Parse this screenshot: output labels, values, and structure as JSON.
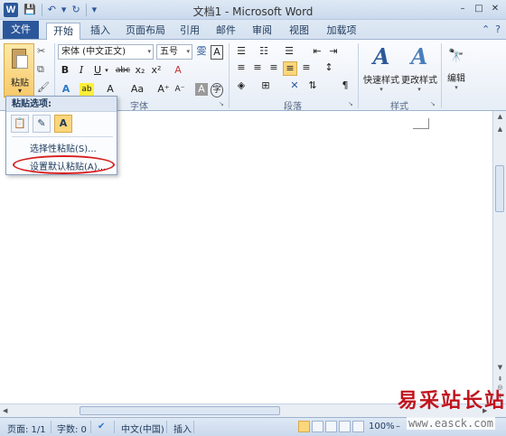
{
  "window": {
    "title": "文档1 - Microsoft Word",
    "app_icon": "W",
    "qat": {
      "save": "💾",
      "undo": "↶",
      "undo_caret": "▾",
      "redo": "↻",
      "customize": "▾"
    },
    "controls": {
      "minimize": "–",
      "restore": "□",
      "close": "✕"
    }
  },
  "tabs": {
    "file": "文件",
    "items": [
      "开始",
      "插入",
      "页面布局",
      "引用",
      "邮件",
      "审阅",
      "视图",
      "加载项"
    ],
    "active_index": 0,
    "help": [
      "⌃",
      "?"
    ]
  },
  "ribbon": {
    "clipboard": {
      "paste_label": "粘贴",
      "caret": "▾",
      "cut": "✂",
      "copy": "⧉",
      "format_painter": "🖌"
    },
    "font": {
      "label": "字体",
      "font_name": "宋体 (中文正文)",
      "font_size": "五号",
      "caret": "▾",
      "phonetic": "雯",
      "char_border": "A",
      "grow": "A",
      "shrink": "A",
      "bold": "B",
      "italic": "I",
      "underline": "U",
      "strike": "abc",
      "subscript": "x₂",
      "superscript": "x²",
      "clear_format": "A",
      "text_effect": "A",
      "highlight": "ab",
      "font_color": "A",
      "change_case": "Aa",
      "enlarge": "A⁺",
      "reduce": "A⁻",
      "char_shading": "A",
      "enclosed": "字"
    },
    "paragraph": {
      "label": "段落",
      "bullets": "☰",
      "numbering": "☷",
      "multilevel": "☰",
      "decrease_indent": "⇤",
      "increase_indent": "⇥",
      "align_left": "≡",
      "center": "≡",
      "align_right": "≡",
      "justify": "≡",
      "distributed": "≡",
      "line_spacing": "↕",
      "shading": "◈",
      "borders": "⊞",
      "chinese_layout": "✕",
      "sort": "⇅",
      "show_marks": "¶"
    },
    "styles": {
      "label": "样式",
      "quick_styles": "快速样式",
      "change_styles": "更改样式",
      "glyph": "A",
      "caret": "▾"
    },
    "editing": {
      "label": "编辑",
      "glyph": "🔭",
      "caret": "▾"
    },
    "launcher": "↘"
  },
  "paste_menu": {
    "header": "粘贴选项:",
    "options": [
      "📋",
      "✎",
      "A"
    ],
    "selective_paste": "选择性粘贴(S)...",
    "set_default": "设置默认粘贴(A)..."
  },
  "scrollbars": {
    "up": "▲",
    "down": "▼",
    "left": "◀",
    "right": "▶",
    "prev_page": "⇞",
    "next_page": "⇟",
    "browse_obj": "◎"
  },
  "status": {
    "page": "页面: 1/1",
    "words": "字数: 0",
    "proofing": "✔",
    "language": "中文(中国)",
    "insert_mode": "插入",
    "zoom": "100%",
    "zoom_minus": "–"
  },
  "watermark": {
    "text": "易采站长站",
    "url": "www.easck.com"
  }
}
